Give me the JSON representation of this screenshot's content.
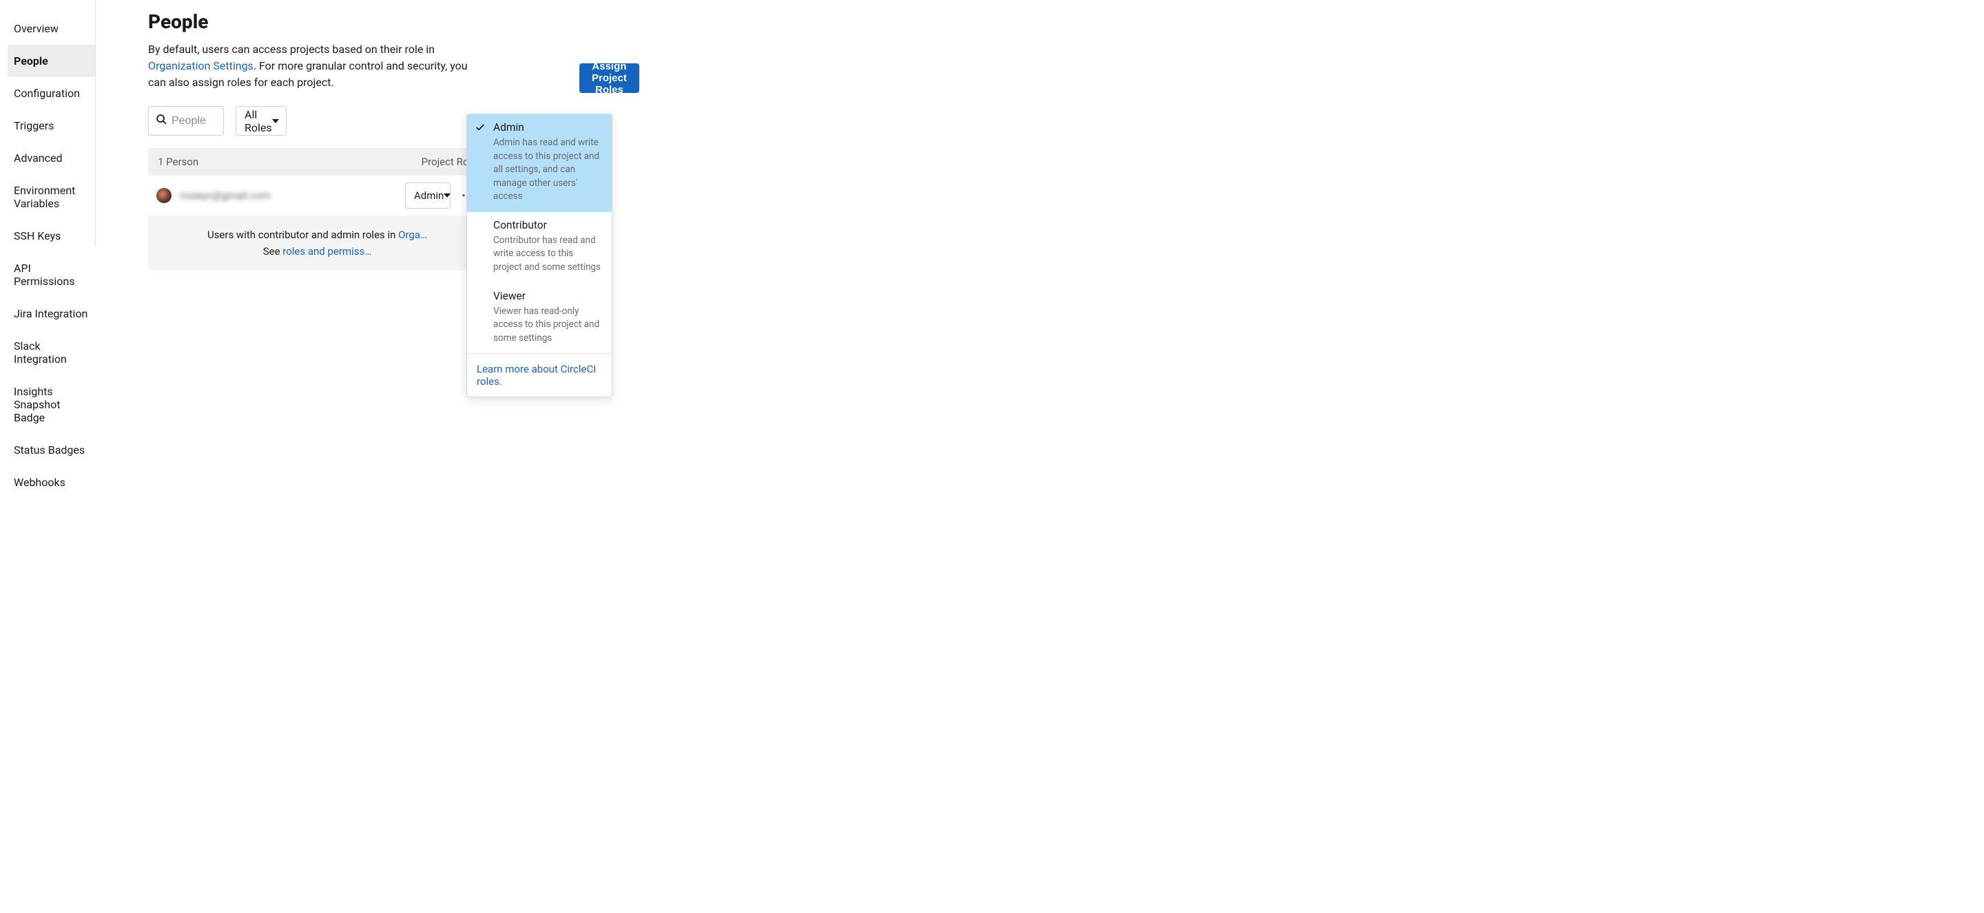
{
  "sidebar": {
    "items": [
      {
        "label": "Overview"
      },
      {
        "label": "People",
        "active": true
      },
      {
        "label": "Configuration"
      },
      {
        "label": "Triggers"
      },
      {
        "label": "Advanced"
      },
      {
        "label": "Environment Variables"
      },
      {
        "label": "SSH Keys"
      },
      {
        "label": "API Permissions"
      },
      {
        "label": "Jira Integration"
      },
      {
        "label": "Slack Integration"
      },
      {
        "label": "Insights Snapshot Badge"
      },
      {
        "label": "Status Badges"
      },
      {
        "label": "Webhooks"
      }
    ]
  },
  "main": {
    "title": "People",
    "description_pre": "By default, users can access projects based on their role in ",
    "description_link": "Organization Settings",
    "description_post": ". For more granular control and security, you can also assign roles for each project.",
    "search_placeholder": "People",
    "role_filter_label": "All Roles",
    "assign_button": "Assign Project Roles",
    "table": {
      "col_person": "1 Person",
      "col_role": "Project Role",
      "rows": [
        {
          "email": "rosieyc@gmail.com",
          "role": "Admin"
        }
      ]
    },
    "footer_pre": "Users with contributor and admin roles in ",
    "footer_link1": "Orga…",
    "footer_mid": " See ",
    "footer_link2": "roles and permiss…"
  },
  "dropdown": {
    "options": [
      {
        "title": "Admin",
        "desc": "Admin has read and write access to this project and all settings, and can manage other users' access",
        "selected": true
      },
      {
        "title": "Contributor",
        "desc": "Contributor has read and write access to this project and some settings",
        "selected": false
      },
      {
        "title": "Viewer",
        "desc": "Viewer has read-only access to this project and some settings",
        "selected": false
      }
    ],
    "learn_more": "Learn more about CircleCI roles."
  }
}
